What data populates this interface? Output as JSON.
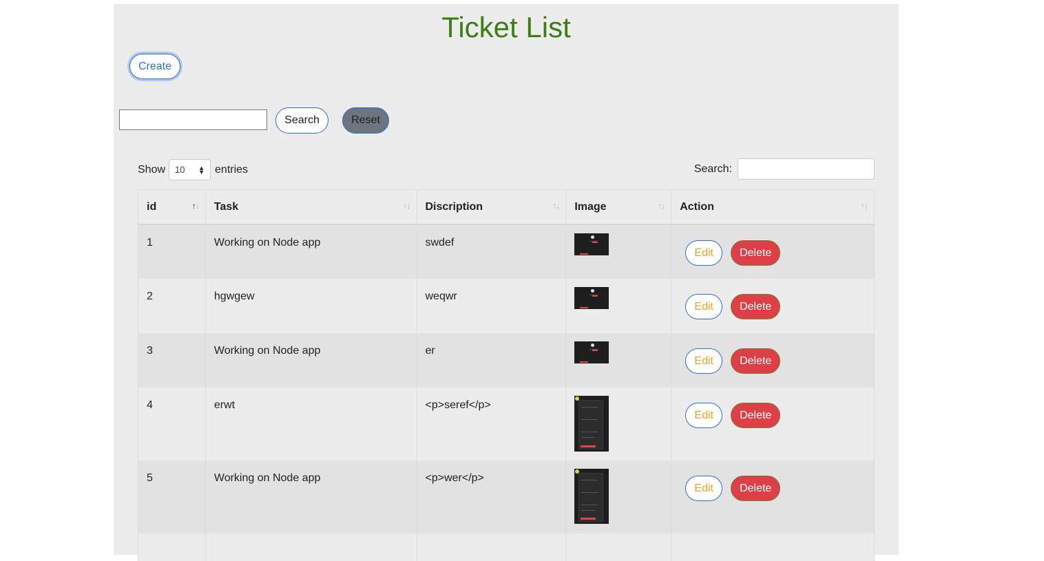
{
  "page": {
    "title": "Ticket List"
  },
  "toolbar": {
    "create_label": "Create",
    "filter_value": "",
    "search_label": "Search",
    "reset_label": "Reset"
  },
  "datatable": {
    "show_label": "Show",
    "entries_value": "10",
    "entries_label": "entries",
    "search_label": "Search:",
    "search_value": ""
  },
  "table": {
    "columns": [
      "id",
      "Task",
      "Discription",
      "Image",
      "Action"
    ],
    "rows": [
      {
        "id": "1",
        "task": "Working on Node app",
        "description": "swdef",
        "image": "landscape-screenshot-thumbnail",
        "edit": "Edit",
        "delete": "Delete"
      },
      {
        "id": "2",
        "task": "hgwgew",
        "description": "weqwr",
        "image": "landscape-screenshot-thumbnail",
        "edit": "Edit",
        "delete": "Delete"
      },
      {
        "id": "3",
        "task": "Working on Node app",
        "description": "er",
        "image": "landscape-screenshot-thumbnail",
        "edit": "Edit",
        "delete": "Delete"
      },
      {
        "id": "4",
        "task": "erwt",
        "description": "<p>seref</p>",
        "image": "portrait-screenshot-thumbnail",
        "edit": "Edit",
        "delete": "Delete"
      },
      {
        "id": "5",
        "task": "Working on Node app",
        "description": "<p>wer</p>",
        "image": "portrait-screenshot-thumbnail",
        "edit": "Edit",
        "delete": "Delete"
      }
    ]
  },
  "colors": {
    "title": "#3d7e12",
    "primary_outline": "#2a6fd6",
    "edit_text": "#f0a020",
    "delete_bg": "#dc3f45",
    "reset_bg": "#6c757d",
    "panel_bg": "#ececec"
  },
  "icons": {
    "sort": "sort-arrows-icon",
    "select": "select-arrows-icon"
  }
}
